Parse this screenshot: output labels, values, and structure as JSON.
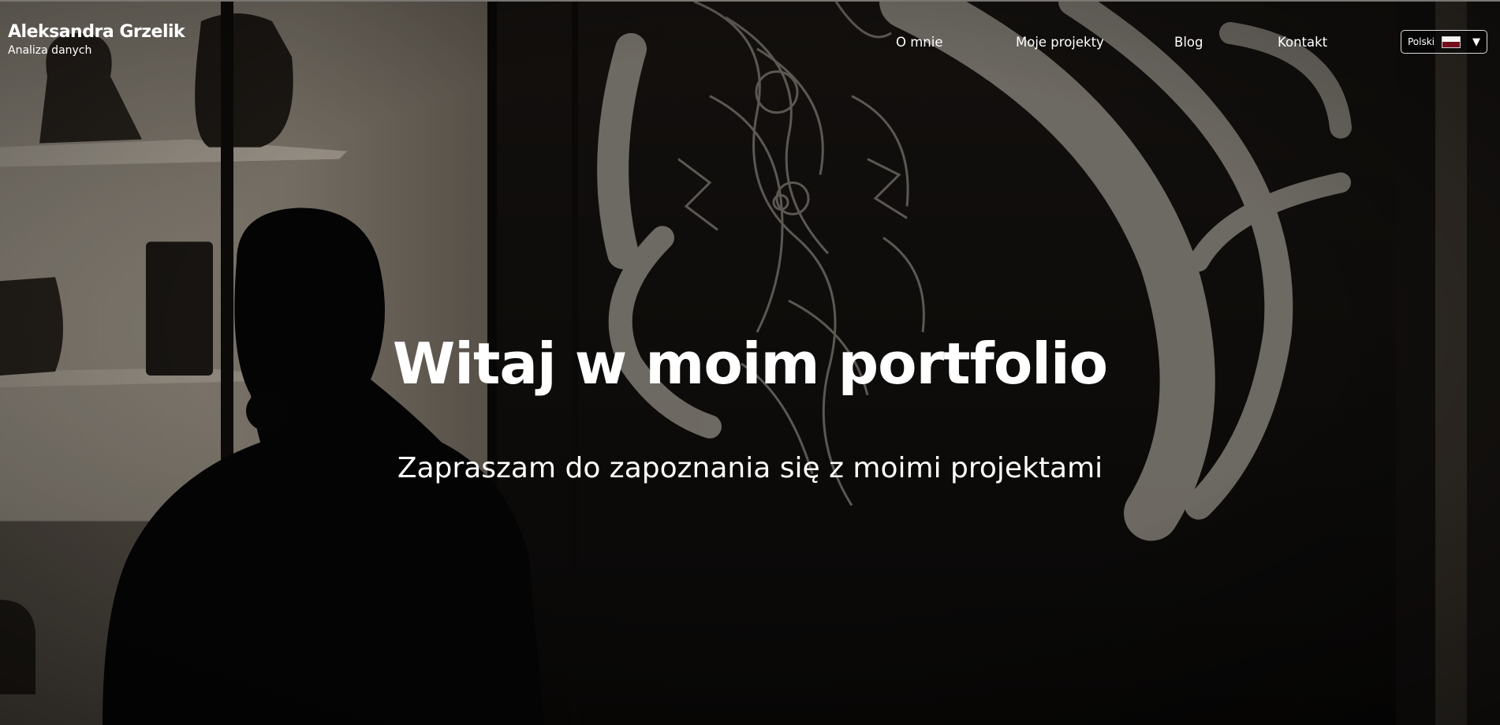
{
  "header": {
    "brand_name": "Aleksandra Grzelik",
    "brand_subtitle": "Analiza danych"
  },
  "nav": {
    "items": [
      {
        "label": "O mnie"
      },
      {
        "label": "Moje projekty"
      },
      {
        "label": "Blog"
      },
      {
        "label": "Kontakt"
      }
    ]
  },
  "language_selector": {
    "selected": "Polski",
    "flag_icon": "poland-flag-icon",
    "caret_icon": "caret-down-icon"
  },
  "hero": {
    "title": "Witaj w moim portfolio",
    "subtitle": "Zapraszam do zapoznania się z moimi projektami"
  },
  "colors": {
    "text": "#ffffff",
    "background": "#0e0c0b",
    "selector_border": "#d9d9d9"
  }
}
